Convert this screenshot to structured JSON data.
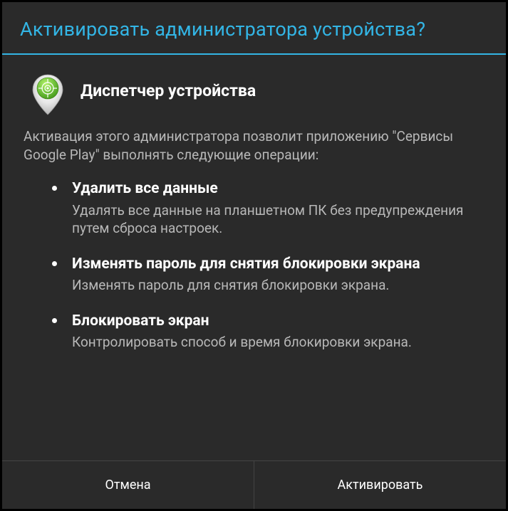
{
  "dialog": {
    "title": "Активировать администратора устройства?",
    "app_name": "Диспетчер устройства",
    "intro": "Активация этого администратора позволит приложению \"Сервисы Google Play\" выполнять следующие операции:",
    "permissions": [
      {
        "title": "Удалить все данные",
        "desc": "Удалять все данные на планшетном ПК без предупреждения путем сброса настроек."
      },
      {
        "title": "Изменять пароль для снятия блокировки экрана",
        "desc": "Изменять пароль для снятия блокировки экрана."
      },
      {
        "title": "Блокировать экран",
        "desc": "Контролировать способ и время блокировки экрана."
      }
    ],
    "buttons": {
      "cancel": "Отмена",
      "activate": "Активировать"
    }
  }
}
